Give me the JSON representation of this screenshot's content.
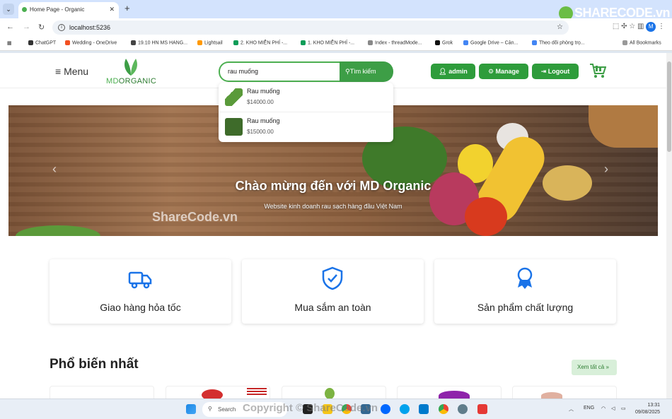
{
  "browser": {
    "tab_title": "Home Page - Organic",
    "url": "localhost:5236",
    "bookmarks": [
      "ChatGPT",
      "Wedding - OneDrive",
      "19.10 HN MS HANG...",
      "Lightsail",
      "2. KHO MIỄN PHÍ -...",
      "1. KHO MIỄN PHÍ -...",
      "Index - threadMode...",
      "Grok",
      "Google Drive – Cản...",
      "Theo dõi phòng trọ...",
      "All Bookmarks"
    ],
    "profile_initial": "M"
  },
  "watermark_logo": "SHARECODE.vn",
  "header": {
    "menu_label": "Menu",
    "logo_text_a": "MD",
    "logo_text_b": "ORGANIC",
    "search_value": "rau muống",
    "search_button": "Tìm kiếm",
    "admin_button": "admin",
    "manage_button": "Manage",
    "logout_button": "Logout"
  },
  "search_results": [
    {
      "name": "Rau muống",
      "price": "$14000.00"
    },
    {
      "name": "Rau muống",
      "price": "$15000.00"
    }
  ],
  "banner": {
    "title": "Chào mừng đến với MD Organic",
    "subtitle": "Website kinh doanh rau sạch hàng đầu Việt Nam",
    "watermark": "ShareCode.vn"
  },
  "features": [
    {
      "label": "Giao hàng hỏa tốc",
      "icon": "truck-icon"
    },
    {
      "label": "Mua sắm an toàn",
      "icon": "shield-check-icon"
    },
    {
      "label": "Sản phẩm chất lượng",
      "icon": "award-icon"
    }
  ],
  "popular": {
    "title": "Phổ biến nhất",
    "see_all": "Xem tất cả »"
  },
  "taskbar": {
    "search_placeholder": "Search",
    "copyright": "Copyright © ShareCode.vn",
    "lang": "ENG",
    "time": "13:31",
    "date": "09/08/2025"
  },
  "colors": {
    "primary_green": "#2e9c3b",
    "accent_blue": "#1a73e8"
  }
}
